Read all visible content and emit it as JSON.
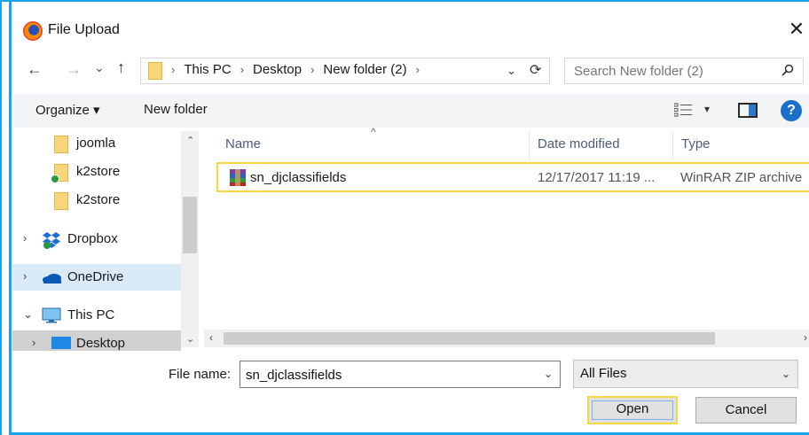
{
  "window": {
    "title": "File Upload",
    "close_glyph": "✕"
  },
  "nav": {
    "back_glyph": "←",
    "forward_glyph": "→",
    "recent_glyph": "⌄",
    "up_glyph": "↑"
  },
  "address": {
    "crumbs": [
      "This PC",
      "Desktop",
      "New folder (2)"
    ],
    "sep_glyph": "›",
    "dropdown_glyph": "⌄",
    "refresh_glyph": "⟳"
  },
  "search": {
    "placeholder": "Search New folder (2)"
  },
  "toolbar": {
    "organize_label": "Organize ▾",
    "new_folder_label": "New folder",
    "view_dropdown_glyph": "▾",
    "help_label": "?"
  },
  "sidebar": {
    "items": [
      {
        "label": "joomla",
        "icon": "folder-icon"
      },
      {
        "label": "k2store",
        "icon": "folder-sync-icon"
      },
      {
        "label": "k2store",
        "icon": "folder-icon"
      },
      {
        "label": "Dropbox",
        "icon": "dropbox-icon",
        "chevron": "›"
      },
      {
        "label": "OneDrive",
        "icon": "onedrive-icon",
        "chevron": "›"
      },
      {
        "label": "This PC",
        "icon": "monitor-icon",
        "chevron": "⌄"
      },
      {
        "label": "Desktop",
        "icon": "desktop-icon",
        "chevron": "›"
      }
    ],
    "scroll_up": "⌃",
    "scroll_down": "⌄"
  },
  "file_list": {
    "columns": [
      "Name",
      "Date modified",
      "Type"
    ],
    "sort_glyph": "^",
    "rows": [
      {
        "name": "sn_djclassifields",
        "date": "12/17/2017 11:19 ...",
        "type": "WinRAR ZIP archive"
      }
    ],
    "scroll_left": "‹",
    "scroll_right": "›"
  },
  "footer": {
    "file_name_label": "File name:",
    "file_name_value": "sn_djclassifields",
    "file_name_dd": "⌄",
    "filter_value": "All Files",
    "filter_dd": "⌄",
    "open_label": "Open",
    "cancel_label": "Cancel"
  },
  "colors": {
    "accent": "#1aa3e8",
    "focus": "#f5d742",
    "help": "#1c6fc9"
  }
}
